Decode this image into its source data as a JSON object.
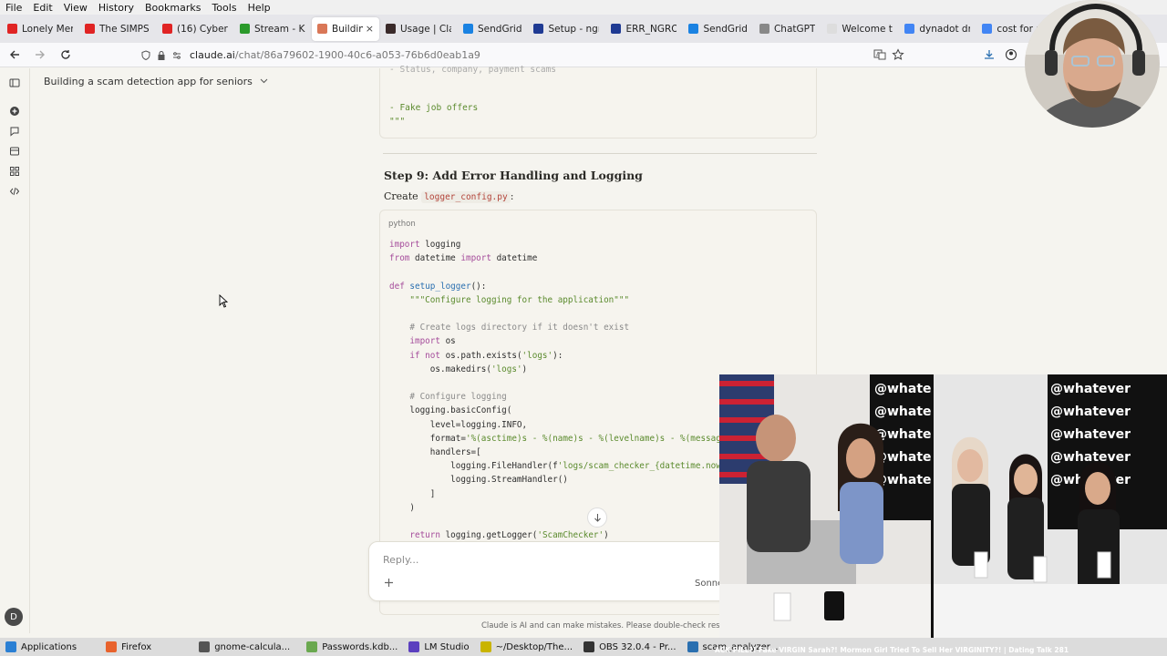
{
  "menu": [
    "File",
    "Edit",
    "View",
    "History",
    "Bookmarks",
    "Tools",
    "Help"
  ],
  "tabs": [
    {
      "label": "Lonely Men",
      "color": "#e02424"
    },
    {
      "label": "The SIMPS I",
      "color": "#e02424"
    },
    {
      "label": "(16) CyberD",
      "color": "#e02424"
    },
    {
      "label": "Stream - Kic",
      "color": "#2b9a2b"
    },
    {
      "label": "Building a",
      "color": "#d97757",
      "active": true
    },
    {
      "label": "Usage | Cla",
      "color": "#3a2a2a"
    },
    {
      "label": "SendGrid",
      "color": "#1a82e2"
    },
    {
      "label": "Setup - ngr",
      "color": "#1f3a93"
    },
    {
      "label": "ERR_NGRO",
      "color": "#1f3a93"
    },
    {
      "label": "SendGrid",
      "color": "#1a82e2"
    },
    {
      "label": "ChatGPT",
      "color": "#888888"
    },
    {
      "label": "Welcome to se",
      "color": "#dddddd"
    },
    {
      "label": "dynadot dn",
      "color": "#4285f4"
    },
    {
      "label": "cost for an",
      "color": "#4285f4"
    }
  ],
  "url": {
    "domain": "claude.ai",
    "path": "/chat/86a79602-1900-40c6-a053-76b6d0eab1a9"
  },
  "chat_title": "Building a scam detection app for seniors",
  "prev_code": {
    "line1": "- Fake job offers",
    "line2": "\"\"\""
  },
  "step_heading": "Step 9: Add Error Handling and Logging",
  "create_text": "Create",
  "create_file": "logger_config.py",
  "create_suffix": ":",
  "code_lang": "python",
  "reply_placeholder": "Reply...",
  "model_label": "Sonne",
  "disclaimer": "Claude is AI and can make mistakes. Please double-check responses.",
  "avatar_letter": "D",
  "taskbar": [
    {
      "label": "Applications",
      "color": "#2a7fd4"
    },
    {
      "label": "Firefox",
      "color": "#e8622c"
    },
    {
      "label": "gnome-calcula...",
      "color": "#555555"
    },
    {
      "label": "Passwords.kdb...",
      "color": "#6aa84f"
    },
    {
      "label": "LM Studio",
      "color": "#5b3fbf"
    },
    {
      "label": "~/Desktop/The...",
      "color": "#c9b400"
    },
    {
      "label": "OBS 32.0.4 - Pr...",
      "color": "#333333"
    },
    {
      "label": "scam_analyzer...",
      "color": "#2a6fb0"
    }
  ],
  "video_title": "ACK PILL?! Fake VIRGIN Sarah?! Mormon Girl Tried To Sell Her VIRGINITY?! | Dating Talk 281"
}
